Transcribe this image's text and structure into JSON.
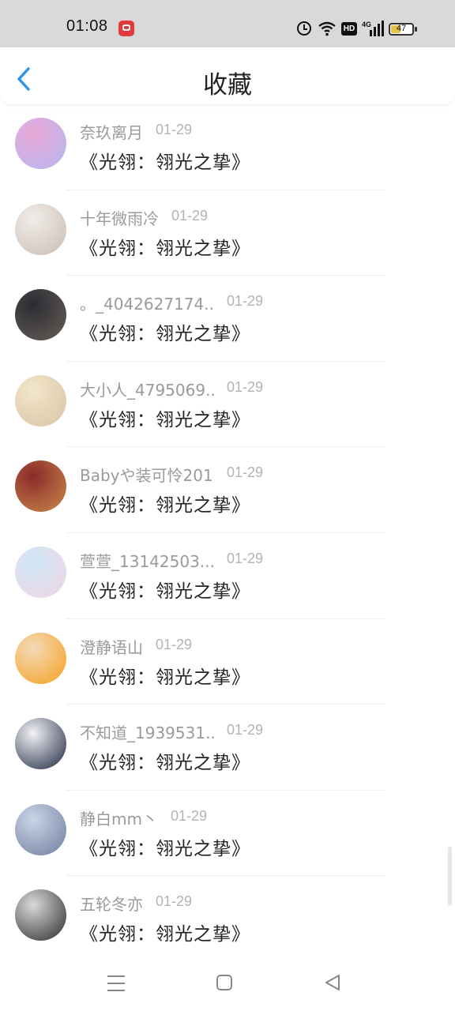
{
  "status_bar": {
    "time": "01:08",
    "hd_label": "HD",
    "network_label": "4G",
    "battery": "47"
  },
  "header": {
    "title": "收藏"
  },
  "favorites": [
    {
      "name": "奈玖离月",
      "date": "01-29",
      "title": "《光翎：翎光之挚》",
      "avatar_colors": [
        "#e9a9d8",
        "#b6b7f0"
      ]
    },
    {
      "name": "十年微雨冷",
      "date": "01-29",
      "title": "《光翎：翎光之挚》",
      "avatar_colors": [
        "#f1ece8",
        "#c9bdb3"
      ]
    },
    {
      "name": "。_4042627174...",
      "date": "01-29",
      "title": "《光翎：翎光之挚》",
      "avatar_colors": [
        "#2a2c33",
        "#6a5e58"
      ]
    },
    {
      "name": "大小人_4795069...",
      "date": "01-29",
      "title": "《光翎：翎光之挚》",
      "avatar_colors": [
        "#f3e6c9",
        "#d7c4a6"
      ]
    },
    {
      "name": "Babyや装可怜201...",
      "date": "01-29",
      "title": "《光翎：翎光之挚》",
      "avatar_colors": [
        "#8b2a2a",
        "#c98a4a"
      ]
    },
    {
      "name": "萱萱_13142503...",
      "date": "01-29",
      "title": "《光翎：翎光之挚》",
      "avatar_colors": [
        "#cfe6f6",
        "#f0d6e4"
      ]
    },
    {
      "name": "澄静语山",
      "date": "01-29",
      "title": "《光翎：翎光之挚》",
      "avatar_colors": [
        "#f4d9b8",
        "#f4a11f"
      ]
    },
    {
      "name": "不知道_1939531...",
      "date": "01-29",
      "title": "《光翎：翎光之挚》",
      "avatar_colors": [
        "#f2f2f6",
        "#1e2740"
      ]
    },
    {
      "name": "静白mm丶",
      "date": "01-29",
      "title": "《光翎：翎光之挚》",
      "avatar_colors": [
        "#c9d4e6",
        "#6f7e9e"
      ]
    },
    {
      "name": "五轮冬亦",
      "date": "01-29",
      "title": "《光翎：翎光之挚》",
      "avatar_colors": [
        "#d9d9d9",
        "#2b2b2b"
      ]
    }
  ],
  "colors": {
    "accent": "#2f95e6",
    "status_bar_bg": "#d9d9d9",
    "name_text": "#9a9a9a",
    "date_text": "#b3b3b3",
    "title_text": "#222222"
  },
  "icons": {
    "back": "chevron-left-icon",
    "nav_menu": "menu-icon",
    "nav_home": "home-square-icon",
    "nav_back": "triangle-back-icon"
  }
}
